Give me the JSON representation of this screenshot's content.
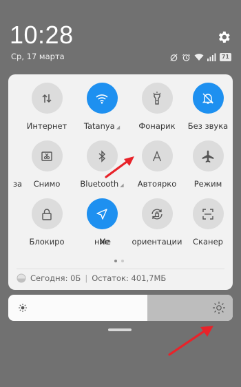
{
  "clock": "10:28",
  "date": "Ср, 17 марта",
  "status": {
    "icons": [
      "alarm-off-icon",
      "alarm-icon",
      "wifi-icon",
      "signal-icon"
    ],
    "battery": "71"
  },
  "tiles": [
    {
      "label": "Интернет",
      "icon": "mobile-data-icon",
      "active": false,
      "tri": ""
    },
    {
      "label": "Tatanya",
      "icon": "wifi-icon",
      "active": true,
      "tri": "◢"
    },
    {
      "label": "Фонарик",
      "icon": "flashlight-icon",
      "active": false,
      "tri": ""
    },
    {
      "label": "Без звука",
      "icon": "bell-off-icon",
      "active": true,
      "tri": ""
    },
    {
      "label": "за",
      "icon": "screenshot-icon",
      "active": false,
      "tri": ""
    },
    {
      "label": "Снимо",
      "icon": "screenshot-icon",
      "active": false,
      "tri": ""
    },
    {
      "label": "Bluetooth",
      "icon": "bluetooth-icon",
      "active": false,
      "tri": "◢"
    },
    {
      "label": "Автояркo",
      "icon": "auto-brightness-icon",
      "active": false,
      "tri": ""
    },
    {
      "label": "Режим",
      "icon": "airplane-icon",
      "active": false,
      "tri": ""
    },
    {
      "label": "Блокиро",
      "icon": "lock-icon",
      "active": false,
      "tri": ""
    },
    {
      "label": "ние",
      "icon": "location-icon",
      "active": true,
      "tri": ""
    },
    {
      "label": "Ме",
      "icon": "rotation-lock-icon",
      "active": false,
      "tri": ""
    },
    {
      "label": "ориентации",
      "icon": "rotation-lock-icon",
      "active": false,
      "tri": ""
    },
    {
      "label": "Сканер",
      "icon": "scanner-icon",
      "active": false,
      "tri": ""
    }
  ],
  "usage": {
    "today": "Сегодня: 0Б",
    "remaining": "Остаток: 401,7МБ"
  },
  "brightness": {
    "level": 0.62
  },
  "annotation_color": "#e8232a"
}
